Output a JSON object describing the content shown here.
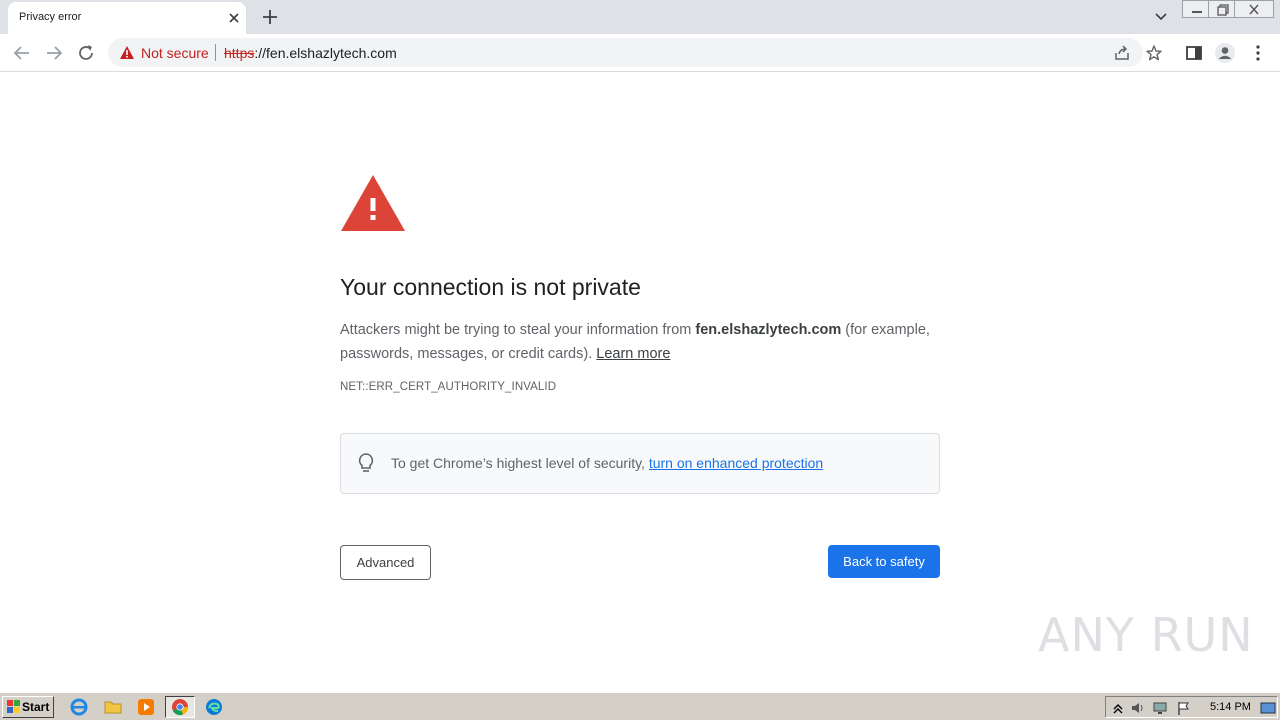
{
  "browser": {
    "tab": {
      "title": "Privacy error"
    },
    "omnibox": {
      "security_label": "Not secure",
      "url_scheme": "https",
      "url_rest": "://fen.elshazlytech.com"
    }
  },
  "interstitial": {
    "heading": "Your connection is not private",
    "desc_before": "Attackers might be trying to steal your information from ",
    "host": "fen.elshazlytech.com",
    "desc_after": " (for example, passwords, messages, or credit cards). ",
    "learn_more": "Learn more",
    "error_code": "NET::ERR_CERT_AUTHORITY_INVALID",
    "enhanced_text": "To get Chrome’s highest level of security, ",
    "enhanced_link": "turn on enhanced protection",
    "advanced_label": "Advanced",
    "back_label": "Back to safety"
  },
  "colors": {
    "danger": "#c5221f",
    "warning_triangle": "#db4437",
    "primary": "#1a73e8"
  },
  "watermark": "ANY RUN",
  "taskbar": {
    "start_label": "Start",
    "apps": [
      "internet-explorer-icon",
      "file-explorer-icon",
      "media-player-icon",
      "chrome-icon",
      "edge-icon"
    ],
    "clock": "5:14 PM"
  }
}
